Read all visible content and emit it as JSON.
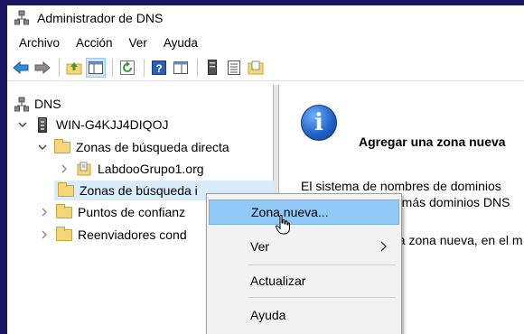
{
  "window": {
    "title": "Administrador de DNS"
  },
  "menu": [
    "Archivo",
    "Acción",
    "Ver",
    "Ayuda"
  ],
  "toolbar": {
    "icons": [
      "back-arrow-icon",
      "forward-arrow-icon",
      "up-folder-icon",
      "show-hide-console-tree-icon",
      "refresh-icon",
      "help-icon",
      "properties-icon",
      "server-icon",
      "list-icon",
      "folder-icon"
    ]
  },
  "tree": {
    "root": "DNS",
    "server": "WIN-G4KJJ4DIQOJ",
    "forward_zones": "Zonas de búsqueda directa",
    "zone_1": "LabdooGrupo1.org",
    "reverse_zones": "Zonas de búsqueda i",
    "trust_points": "Puntos de confianz",
    "forwarders": "Reenviadores cond"
  },
  "detail": {
    "heading": "Agregar una zona nueva",
    "line_1": "El sistema de nombres de dominios",
    "line_2": "o más dominios DNS",
    "line_3": "na zona nueva, en el m"
  },
  "context_menu": {
    "new_zone": "Zona nueva...",
    "view": "Ver",
    "refresh": "Actualizar",
    "help": "Ayuda"
  },
  "colors": {
    "background": "#1a1663",
    "selection": "#91c9f7",
    "tree_selected": "#d9ecfa"
  }
}
